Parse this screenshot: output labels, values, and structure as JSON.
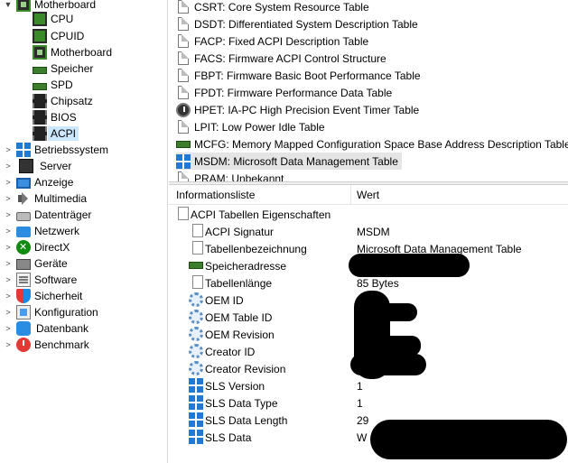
{
  "tree": {
    "items": [
      {
        "label": "Motherboard",
        "icon": "motherboard-icon",
        "level": 0,
        "expander": "collapse"
      },
      {
        "label": "CPU",
        "icon": "cpu-icon",
        "level": 1
      },
      {
        "label": "CPUID",
        "icon": "cpuid-icon",
        "level": 1
      },
      {
        "label": "Motherboard",
        "icon": "motherboard-icon",
        "level": 1
      },
      {
        "label": "Speicher",
        "icon": "memory-icon",
        "level": 1
      },
      {
        "label": "SPD",
        "icon": "spd-icon",
        "level": 1
      },
      {
        "label": "Chipsatz",
        "icon": "chipset-icon",
        "level": 1
      },
      {
        "label": "BIOS",
        "icon": "bios-icon",
        "level": 1
      },
      {
        "label": "ACPI",
        "icon": "acpi-icon",
        "level": 1,
        "selected": true
      },
      {
        "label": "Betriebssystem",
        "icon": "windows-icon",
        "level": 0,
        "expander": "expand"
      },
      {
        "label": "Server",
        "icon": "server-icon",
        "level": 0,
        "expander": "expand"
      },
      {
        "label": "Anzeige",
        "icon": "monitor-icon",
        "level": 0,
        "expander": "expand"
      },
      {
        "label": "Multimedia",
        "icon": "speaker-icon",
        "level": 0,
        "expander": "expand"
      },
      {
        "label": "Datenträger",
        "icon": "disk-icon",
        "level": 0,
        "expander": "expand"
      },
      {
        "label": "Netzwerk",
        "icon": "network-icon",
        "level": 0,
        "expander": "expand"
      },
      {
        "label": "DirectX",
        "icon": "directx-icon",
        "level": 0,
        "expander": "expand"
      },
      {
        "label": "Geräte",
        "icon": "devices-icon",
        "level": 0,
        "expander": "expand"
      },
      {
        "label": "Software",
        "icon": "software-icon",
        "level": 0,
        "expander": "expand"
      },
      {
        "label": "Sicherheit",
        "icon": "security-shield-icon",
        "level": 0,
        "expander": "expand"
      },
      {
        "label": "Konfiguration",
        "icon": "configuration-icon",
        "level": 0,
        "expander": "expand"
      },
      {
        "label": "Datenbank",
        "icon": "database-icon",
        "level": 0,
        "expander": "expand"
      },
      {
        "label": "Benchmark",
        "icon": "benchmark-icon",
        "level": 0,
        "expander": "expand"
      }
    ]
  },
  "table_list": {
    "items": [
      {
        "label": "CSRT: Core System Resource Table",
        "icon": "document-icon"
      },
      {
        "label": "DSDT: Differentiated System Description Table",
        "icon": "document-icon"
      },
      {
        "label": "FACP: Fixed ACPI Description Table",
        "icon": "document-icon"
      },
      {
        "label": "FACS: Firmware ACPI Control Structure",
        "icon": "document-icon"
      },
      {
        "label": "FBPT: Firmware Basic Boot Performance Table",
        "icon": "document-icon"
      },
      {
        "label": "FPDT: Firmware Performance Data Table",
        "icon": "document-icon"
      },
      {
        "label": "HPET: IA-PC High Precision Event Timer Table",
        "icon": "clock-icon"
      },
      {
        "label": "LPIT: Low Power Idle Table",
        "icon": "document-icon"
      },
      {
        "label": "MCFG: Memory Mapped Configuration Space Base Address Description Table",
        "icon": "memory-icon"
      },
      {
        "label": "MSDM: Microsoft Data Management Table",
        "icon": "windows-icon",
        "selected": true
      },
      {
        "label": "PRAM: Unbekannt",
        "icon": "document-icon"
      }
    ]
  },
  "details": {
    "col_field": "Informationsliste",
    "col_value": "Wert",
    "group_title": "ACPI Tabellen Eigenschaften",
    "rows": [
      {
        "name": "ACPI Signatur",
        "value": "MSDM",
        "icon": "document-icon"
      },
      {
        "name": "Tabellenbezeichnung",
        "value": "Microsoft Data Management Table",
        "icon": "document-icon"
      },
      {
        "name": "Speicheradresse",
        "value": "",
        "icon": "memory-icon"
      },
      {
        "name": "Tabellenlänge",
        "value": "85 Bytes",
        "icon": "document-icon"
      },
      {
        "name": "OEM ID",
        "value": "",
        "icon": "gear-icon"
      },
      {
        "name": "OEM Table ID",
        "value": "",
        "icon": "gear-icon"
      },
      {
        "name": "OEM Revision",
        "value": "",
        "icon": "gear-icon"
      },
      {
        "name": "Creator ID",
        "value": "",
        "icon": "gear-icon"
      },
      {
        "name": "Creator Revision",
        "value": "",
        "icon": "gear-icon"
      },
      {
        "name": "SLS Version",
        "value": "1",
        "icon": "windows-icon"
      },
      {
        "name": "SLS Data Type",
        "value": "1",
        "icon": "windows-icon"
      },
      {
        "name": "SLS Data Length",
        "value": "29",
        "icon": "windows-icon"
      },
      {
        "name": "SLS Data",
        "value": "W",
        "icon": "windows-icon"
      }
    ]
  },
  "colors": {
    "selection": "#cce8ff",
    "list_selection": "#e5e5e5",
    "redaction": "#000000"
  }
}
